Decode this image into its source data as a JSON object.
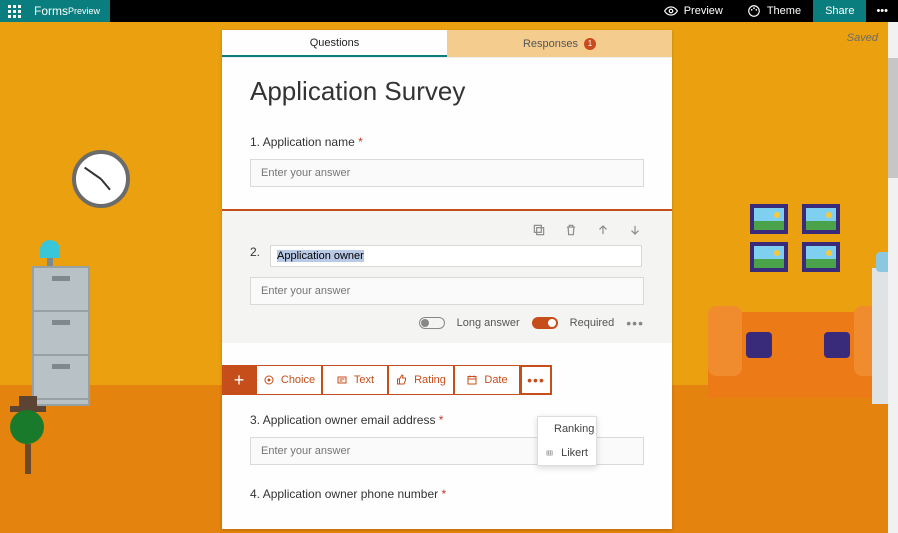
{
  "appbar": {
    "brand": "Forms",
    "brand_suffix": "Preview",
    "preview": "Preview",
    "theme": "Theme",
    "share": "Share"
  },
  "status": {
    "saved": "Saved"
  },
  "tabs": {
    "questions": "Questions",
    "responses": "Responses",
    "responses_count": "1"
  },
  "form": {
    "title": "Application Survey",
    "q1": {
      "num": "1.",
      "label": "Application name",
      "placeholder": "Enter your answer"
    },
    "q2": {
      "num": "2.",
      "label": "Application owner",
      "placeholder": "Enter your answer",
      "long_answer": "Long answer",
      "required": "Required"
    },
    "q3": {
      "num": "3.",
      "label": "Application owner email address",
      "placeholder": "Enter your answer"
    },
    "q4": {
      "num": "4.",
      "label": "Application owner phone number"
    }
  },
  "addrow": {
    "choice": "Choice",
    "text": "Text",
    "rating": "Rating",
    "date": "Date"
  },
  "dropdown": {
    "ranking": "Ranking",
    "likert": "Likert"
  }
}
